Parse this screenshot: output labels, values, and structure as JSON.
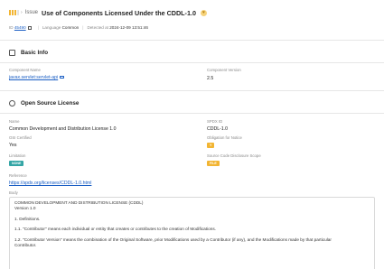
{
  "header": {
    "type_label": "Issue",
    "title": "Use of Components Licensed Under the CDDL-1.0",
    "id_label": "ID",
    "id_value": "45490",
    "language_label": "Language",
    "language_value": "Common",
    "detected_label": "Detected at",
    "detected_value": "2024-12-09 13:51:46",
    "severity_color": "#f2b533"
  },
  "basic_info": {
    "title": "Basic Info",
    "component_name_label": "Component Name",
    "component_name_value": "javax.servlet:servlet-api",
    "component_version_label": "Component Version",
    "component_version_value": "2.5"
  },
  "license": {
    "title": "Open Source License",
    "name_label": "Name",
    "name_value": "Common Development and Distribution License 1.0",
    "spdx_label": "SPDX ID",
    "spdx_value": "CDDL-1.0",
    "osi_label": "OSI Certified",
    "osi_value": "Yes",
    "obligation_label": "Obligation for Notice",
    "obligation_value": "Y",
    "limitation_label": "Limitation",
    "limitation_value": "NONE",
    "scope_label": "Source Code Disclosure Scope",
    "scope_value": "FILE",
    "reference_label": "Reference",
    "reference_value": "https://spdx.org/licenses/CDDL-1.0.html",
    "body_label": "Body",
    "body_lines": [
      "COMMON DEVELOPMENT AND DISTRIBUTION LICENSE (CDDL)",
      "Version 1.0",
      "1. Definitions.",
      "1.1. \"Contributor\" means each individual or entity that creates or contributes to the creation of Modifications.",
      "1.2. \"Contributor Version\" means the combination of the Original Software, prior Modifications used by a Contributor (if any), and the Modifications made by that particular",
      "Contributor."
    ]
  },
  "colors": {
    "accent": "#f2b533",
    "link": "#1a5ec4",
    "teal_badge": "#33a5a5"
  }
}
